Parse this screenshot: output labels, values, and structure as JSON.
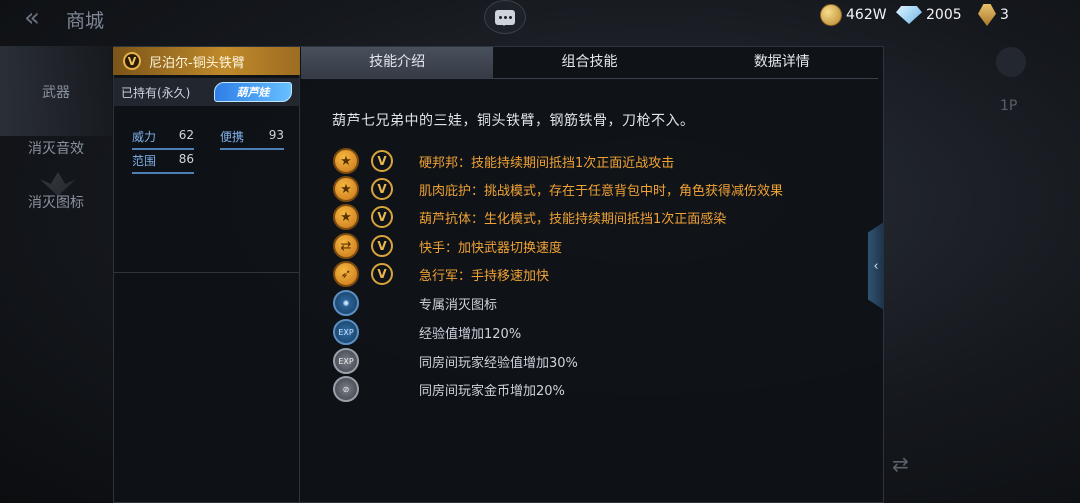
{
  "topbar": {
    "title": "商城",
    "gold": "462W",
    "diamonds": "2005",
    "medals": "3"
  },
  "nav": {
    "items": [
      "武器",
      "消灭音效",
      "消灭图标"
    ]
  },
  "weapon": {
    "name": "尼泊尔-铜头铁臂",
    "owned": "已持有(永久)",
    "series_badge": "葫芦娃",
    "stats": {
      "power_label": "威力",
      "power_value": "62",
      "portable_label": "便携",
      "portable_value": "93",
      "range_label": "范围",
      "range_value": "86"
    }
  },
  "tabs": [
    "技能介绍",
    "组合技能",
    "数据详情"
  ],
  "description": "葫芦七兄弟中的三娃，铜头铁臂，钢筋铁骨，刀枪不入。",
  "skills": [
    {
      "text": "硬邦邦：技能持续期间抵挡1次正面近战攻击",
      "icon": "star-icon"
    },
    {
      "text": "肌肉庇护：挑战模式，存在于任意背包中时，角色获得减伤效果",
      "icon": "star-icon"
    },
    {
      "text": "葫芦抗体：生化模式，技能持续期间抵挡1次正面感染",
      "icon": "star-icon"
    },
    {
      "text": "快手：加快武器切换速度",
      "icon": "swap-icon"
    },
    {
      "text": "急行军：手持移速加快",
      "icon": "running-icon"
    }
  ],
  "perks": [
    {
      "text": "专属消灭图标",
      "icon": "kill-icon"
    },
    {
      "text": "经验值增加120%",
      "icon": "exp-icon"
    },
    {
      "text": "同房间玩家经验值增加30%",
      "icon": "room-exp-icon"
    },
    {
      "text": "同房间玩家金币增加20%",
      "icon": "room-coin-icon"
    }
  ],
  "side": {
    "label_1p": "1P"
  },
  "colors": {
    "accent_gold": "#f0a235",
    "header_gold": "#c08a2a",
    "panel_bg": "#0e1116"
  }
}
